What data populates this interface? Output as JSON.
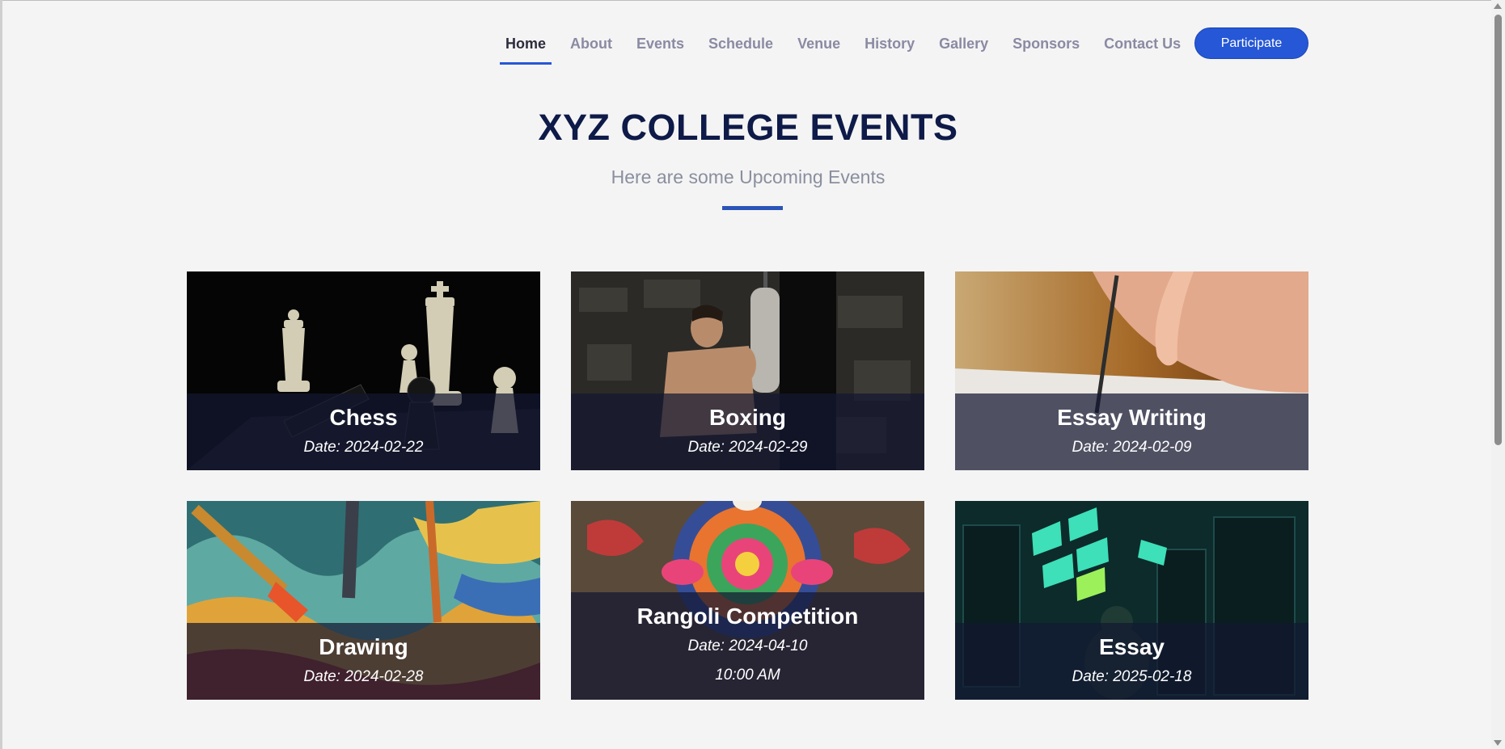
{
  "nav": {
    "items": [
      {
        "label": "Home",
        "active": true
      },
      {
        "label": "About"
      },
      {
        "label": "Events"
      },
      {
        "label": "Schedule"
      },
      {
        "label": "Venue"
      },
      {
        "label": "History"
      },
      {
        "label": "Gallery"
      },
      {
        "label": "Sponsors"
      },
      {
        "label": "Contact Us"
      }
    ],
    "cta_label": "Participate"
  },
  "hero": {
    "title": "XYZ COLLEGE EVENTS",
    "subtitle": "Here are some Upcoming Events"
  },
  "events": [
    {
      "title": "Chess",
      "date": "Date: 2024-02-22"
    },
    {
      "title": "Boxing",
      "date": "Date: 2024-02-29"
    },
    {
      "title": "Essay Writing",
      "date": "Date: 2024-02-09"
    },
    {
      "title": "Drawing",
      "date": "Date: 2024-02-28"
    },
    {
      "title": "Rangoli Competition",
      "date": "Date: 2024-04-10",
      "time": "10:00 AM"
    },
    {
      "title": "Essay",
      "date": "Date: 2025-02-18"
    }
  ],
  "colors": {
    "accent": "#2557d6",
    "title": "#0e1a48",
    "nav_inactive": "#8a8aa3",
    "background": "#f4f4f4"
  }
}
